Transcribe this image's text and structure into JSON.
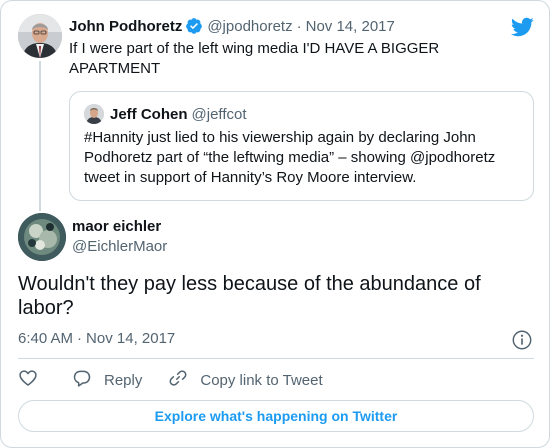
{
  "brand": {
    "logo_icon": "twitter-bird-icon",
    "accent": "#1d9bf0",
    "muted": "#536471",
    "border": "#cfd9de"
  },
  "parent_tweet": {
    "name": "John Podhoretz",
    "verified_icon": "verified-badge-icon",
    "handle": "@jpodhoretz",
    "separator": "·",
    "date": "Nov 14, 2017",
    "text": "If I were part of the left wing media I'D HAVE A BIGGER APARTMENT"
  },
  "quoted_tweet": {
    "name": "Jeff Cohen",
    "handle": "@jeffcot",
    "text": "#Hannity just lied to his viewership again by declaring John Podhoretz part of “the leftwing media” – showing @jpodhoretz tweet in support of Hannity’s Roy Moore interview."
  },
  "main_tweet": {
    "name": "maor eichler",
    "handle": "@EichlerMaor",
    "text": "Wouldn't they pay less because of the abundance of labor?",
    "time": "6:40 AM",
    "separator": "·",
    "date": "Nov 14, 2017",
    "info_icon": "info-icon"
  },
  "actions": {
    "like_icon": "heart-icon",
    "reply_icon": "reply-bubble-icon",
    "reply_label": "Reply",
    "copy_icon": "link-icon",
    "copy_label": "Copy link to Tweet"
  },
  "footer": {
    "explore_label": "Explore what's happening on Twitter"
  }
}
